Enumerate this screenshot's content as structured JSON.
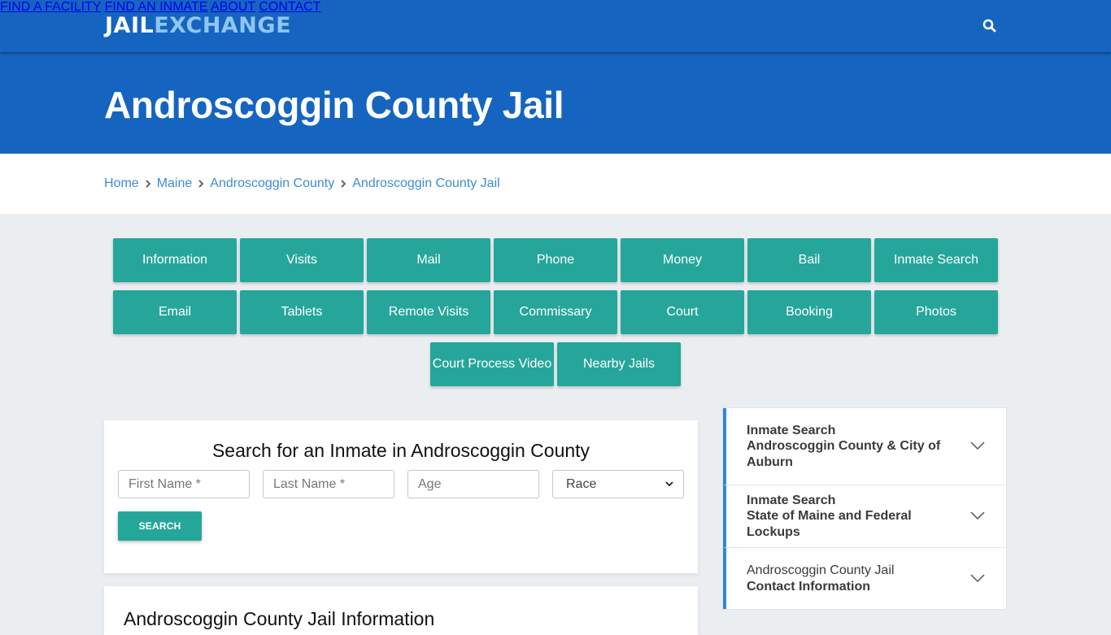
{
  "header": {
    "logo_part1": "JAIL",
    "logo_part2": "EXCHANGE",
    "nav": [
      {
        "label": "FIND A FACILITY"
      },
      {
        "label": "FIND AN INMATE"
      },
      {
        "label": "ABOUT"
      },
      {
        "label": "CONTACT"
      }
    ],
    "search_icon": "search-icon"
  },
  "hero": {
    "title": "Androscoggin County Jail"
  },
  "breadcrumb": [
    {
      "label": "Home"
    },
    {
      "label": "Maine"
    },
    {
      "label": "Androscoggin County"
    },
    {
      "label": "Androscoggin County Jail"
    }
  ],
  "topic_buttons": [
    {
      "label": "Information"
    },
    {
      "label": "Visits"
    },
    {
      "label": "Mail"
    },
    {
      "label": "Phone"
    },
    {
      "label": "Money"
    },
    {
      "label": "Bail"
    },
    {
      "label": "Inmate Search"
    },
    {
      "label": "Email"
    },
    {
      "label": "Tablets"
    },
    {
      "label": "Remote Visits"
    },
    {
      "label": "Commissary"
    },
    {
      "label": "Court"
    },
    {
      "label": "Booking"
    },
    {
      "label": "Photos"
    },
    {
      "label": "Court Process Video"
    },
    {
      "label": "Nearby Jails"
    }
  ],
  "search_form": {
    "title": "Search for an Inmate in Androscoggin County",
    "first_name_placeholder": "First Name *",
    "last_name_placeholder": "Last Name *",
    "age_placeholder": "Age",
    "race_selected": "Race",
    "submit_label": "SEARCH"
  },
  "info_section": {
    "title": "Androscoggin County Jail Information"
  },
  "accordion": [
    {
      "line1": "Inmate Search",
      "line2": "Androscoggin County & City of Auburn",
      "line1_bold": true
    },
    {
      "line1": "Inmate Search",
      "line2": "State of Maine and Federal Lockups",
      "line1_bold": true
    },
    {
      "line1": "Androscoggin County Jail",
      "line2": "Contact Information",
      "line1_bold": false
    }
  ],
  "colors": {
    "brand_blue": "#1565c0",
    "logo_accent": "#8ec5f2",
    "teal_button": "#26a69a",
    "link_blue": "#3d8bd6",
    "accordion_accent": "#2f88d8"
  }
}
